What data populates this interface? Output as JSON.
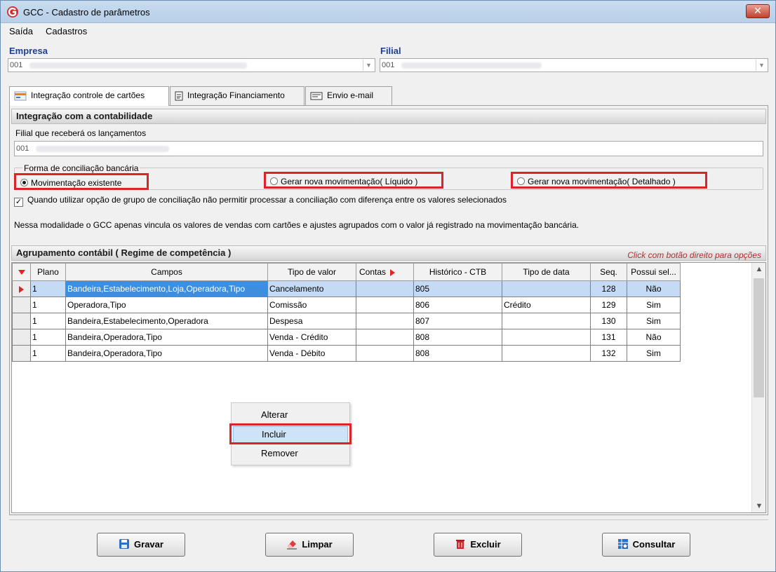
{
  "window": {
    "title": "GCC - Cadastro de parâmetros",
    "close_glyph": "✕"
  },
  "menu": {
    "items": [
      {
        "label": "Saída"
      },
      {
        "label": "Cadastros"
      }
    ]
  },
  "empresa": {
    "label": "Empresa",
    "code": "001"
  },
  "filial": {
    "label": "Filial",
    "code": "001"
  },
  "tabs": [
    {
      "label": "Integração controle de cartões",
      "icon": "card-control-icon"
    },
    {
      "label": "Integração Financiamento",
      "icon": "document-icon"
    },
    {
      "label": "Envio e-mail",
      "icon": "email-icon"
    }
  ],
  "contabilidade": {
    "header": "Integração com a contabilidade",
    "filial_label": "Filial que receberá os lançamentos",
    "filial_code": "001"
  },
  "conciliacao": {
    "legend": "Forma de conciliação bancária",
    "options": [
      {
        "label": "Movimentação existente",
        "checked": true
      },
      {
        "label": "Gerar nova movimentação( Líquido )",
        "checked": false
      },
      {
        "label": "Gerar nova movimentação( Detalhado )",
        "checked": false
      }
    ],
    "checkbox_label": "Quando utilizar opção de grupo de conciliação não permitir processar a conciliação com diferença entre os valores selecionados",
    "checkbox_checked": true,
    "info_text": "Nessa modalidade o GCC apenas vincula os valores de vendas com cartões e ajustes agrupados com o valor já registrado na movimentação bancária."
  },
  "agrupamento": {
    "header": "Agrupamento contábil ( Regime de competência )",
    "hint": "Click com botão direito para opções",
    "columns": [
      "Plano",
      "Campos",
      "Tipo de valor",
      "Contas",
      "Histórico - CTB",
      "Tipo de data",
      "Seq.",
      "Possui sel..."
    ],
    "rows": [
      {
        "plano": "1",
        "campos": "Bandeira,Estabelecimento,Loja,Operadora,Tipo",
        "tipo_valor": "Cancelamento",
        "contas": "",
        "historico": "805",
        "tipo_data": "",
        "seq": "128",
        "possui_sel": "Não",
        "selected": true
      },
      {
        "plano": "1",
        "campos": "Operadora,Tipo",
        "tipo_valor": "Comissão",
        "contas": "",
        "historico": "806",
        "tipo_data": "Crédito",
        "seq": "129",
        "possui_sel": "Sim",
        "selected": false
      },
      {
        "plano": "1",
        "campos": "Bandeira,Estabelecimento,Operadora",
        "tipo_valor": "Despesa",
        "contas": "",
        "historico": "807",
        "tipo_data": "",
        "seq": "130",
        "possui_sel": "Sim",
        "selected": false
      },
      {
        "plano": "1",
        "campos": "Bandeira,Operadora,Tipo",
        "tipo_valor": "Venda - Crédito",
        "contas": "",
        "historico": "808",
        "tipo_data": "",
        "seq": "131",
        "possui_sel": "Não",
        "selected": false
      },
      {
        "plano": "1",
        "campos": "Bandeira,Operadora,Tipo",
        "tipo_valor": "Venda - Débito",
        "contas": "",
        "historico": "808",
        "tipo_data": "",
        "seq": "132",
        "possui_sel": "Sim",
        "selected": false
      }
    ]
  },
  "context_menu": {
    "items": [
      {
        "label": "Alterar"
      },
      {
        "label": "Incluir"
      },
      {
        "label": "Remover"
      }
    ]
  },
  "buttons": [
    {
      "label": "Gravar",
      "icon": "save-icon"
    },
    {
      "label": "Limpar",
      "icon": "eraser-icon"
    },
    {
      "label": "Excluir",
      "icon": "trash-icon"
    },
    {
      "label": "Consultar",
      "icon": "search-table-icon"
    }
  ],
  "colors": {
    "highlight_red": "#d9242a",
    "label_blue": "#1c3f93",
    "selection_blue": "#3c8ee0",
    "hint_red": "#b03030"
  }
}
